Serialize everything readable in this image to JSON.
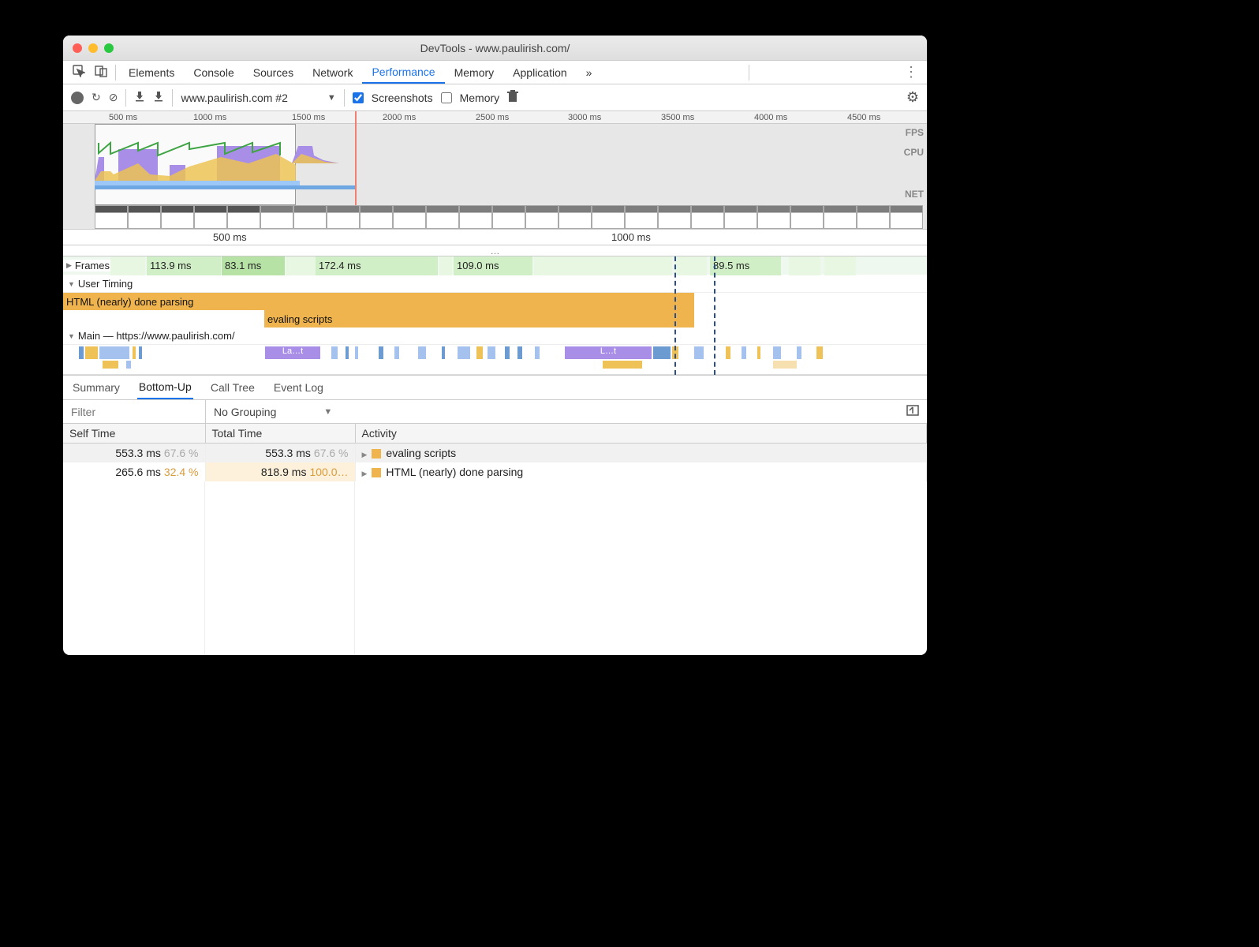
{
  "window": {
    "title": "DevTools - www.paulirish.com/"
  },
  "panels": {
    "items": [
      "Elements",
      "Console",
      "Sources",
      "Network",
      "Performance",
      "Memory",
      "Application"
    ],
    "active": "Performance",
    "overflow": "»"
  },
  "toolbar": {
    "recording": "www.paulirish.com #2",
    "screenshots_label": "Screenshots",
    "memory_label": "Memory",
    "screenshots_checked": true,
    "memory_checked": false
  },
  "overview": {
    "ticks": [
      "500 ms",
      "1000 ms",
      "1500 ms",
      "2000 ms",
      "2500 ms",
      "3000 ms",
      "3500 ms",
      "4000 ms",
      "4500 ms"
    ],
    "lanes": [
      "FPS",
      "CPU",
      "NET"
    ]
  },
  "ruler": {
    "ticks": [
      "500 ms",
      "1000 ms"
    ],
    "ellipsis": "…"
  },
  "frames": {
    "header": "Frames",
    "segments": [
      "113.9 ms",
      "83.1 ms",
      "172.4 ms",
      "109.0 ms",
      "89.5 ms"
    ]
  },
  "usertiming": {
    "header": "User Timing",
    "bars": [
      "HTML (nearly) done parsing",
      "evaling scripts"
    ]
  },
  "main": {
    "header": "Main — https://www.paulirish.com/",
    "short1": "La…t",
    "short2": "L…t"
  },
  "detail_tabs": {
    "items": [
      "Summary",
      "Bottom-Up",
      "Call Tree",
      "Event Log"
    ],
    "active": "Bottom-Up"
  },
  "filter": {
    "placeholder": "Filter",
    "grouping": "No Grouping"
  },
  "table": {
    "cols": [
      "Self Time",
      "Total Time",
      "Activity"
    ],
    "rows": [
      {
        "self": "553.3 ms",
        "self_pct": "67.6 %",
        "total": "553.3 ms",
        "total_pct": "67.6 %",
        "activity": "evaling scripts"
      },
      {
        "self": "265.6 ms",
        "self_pct": "32.4 %",
        "total": "818.9 ms",
        "total_pct": "100.0…",
        "activity": "HTML (nearly) done parsing"
      }
    ]
  }
}
